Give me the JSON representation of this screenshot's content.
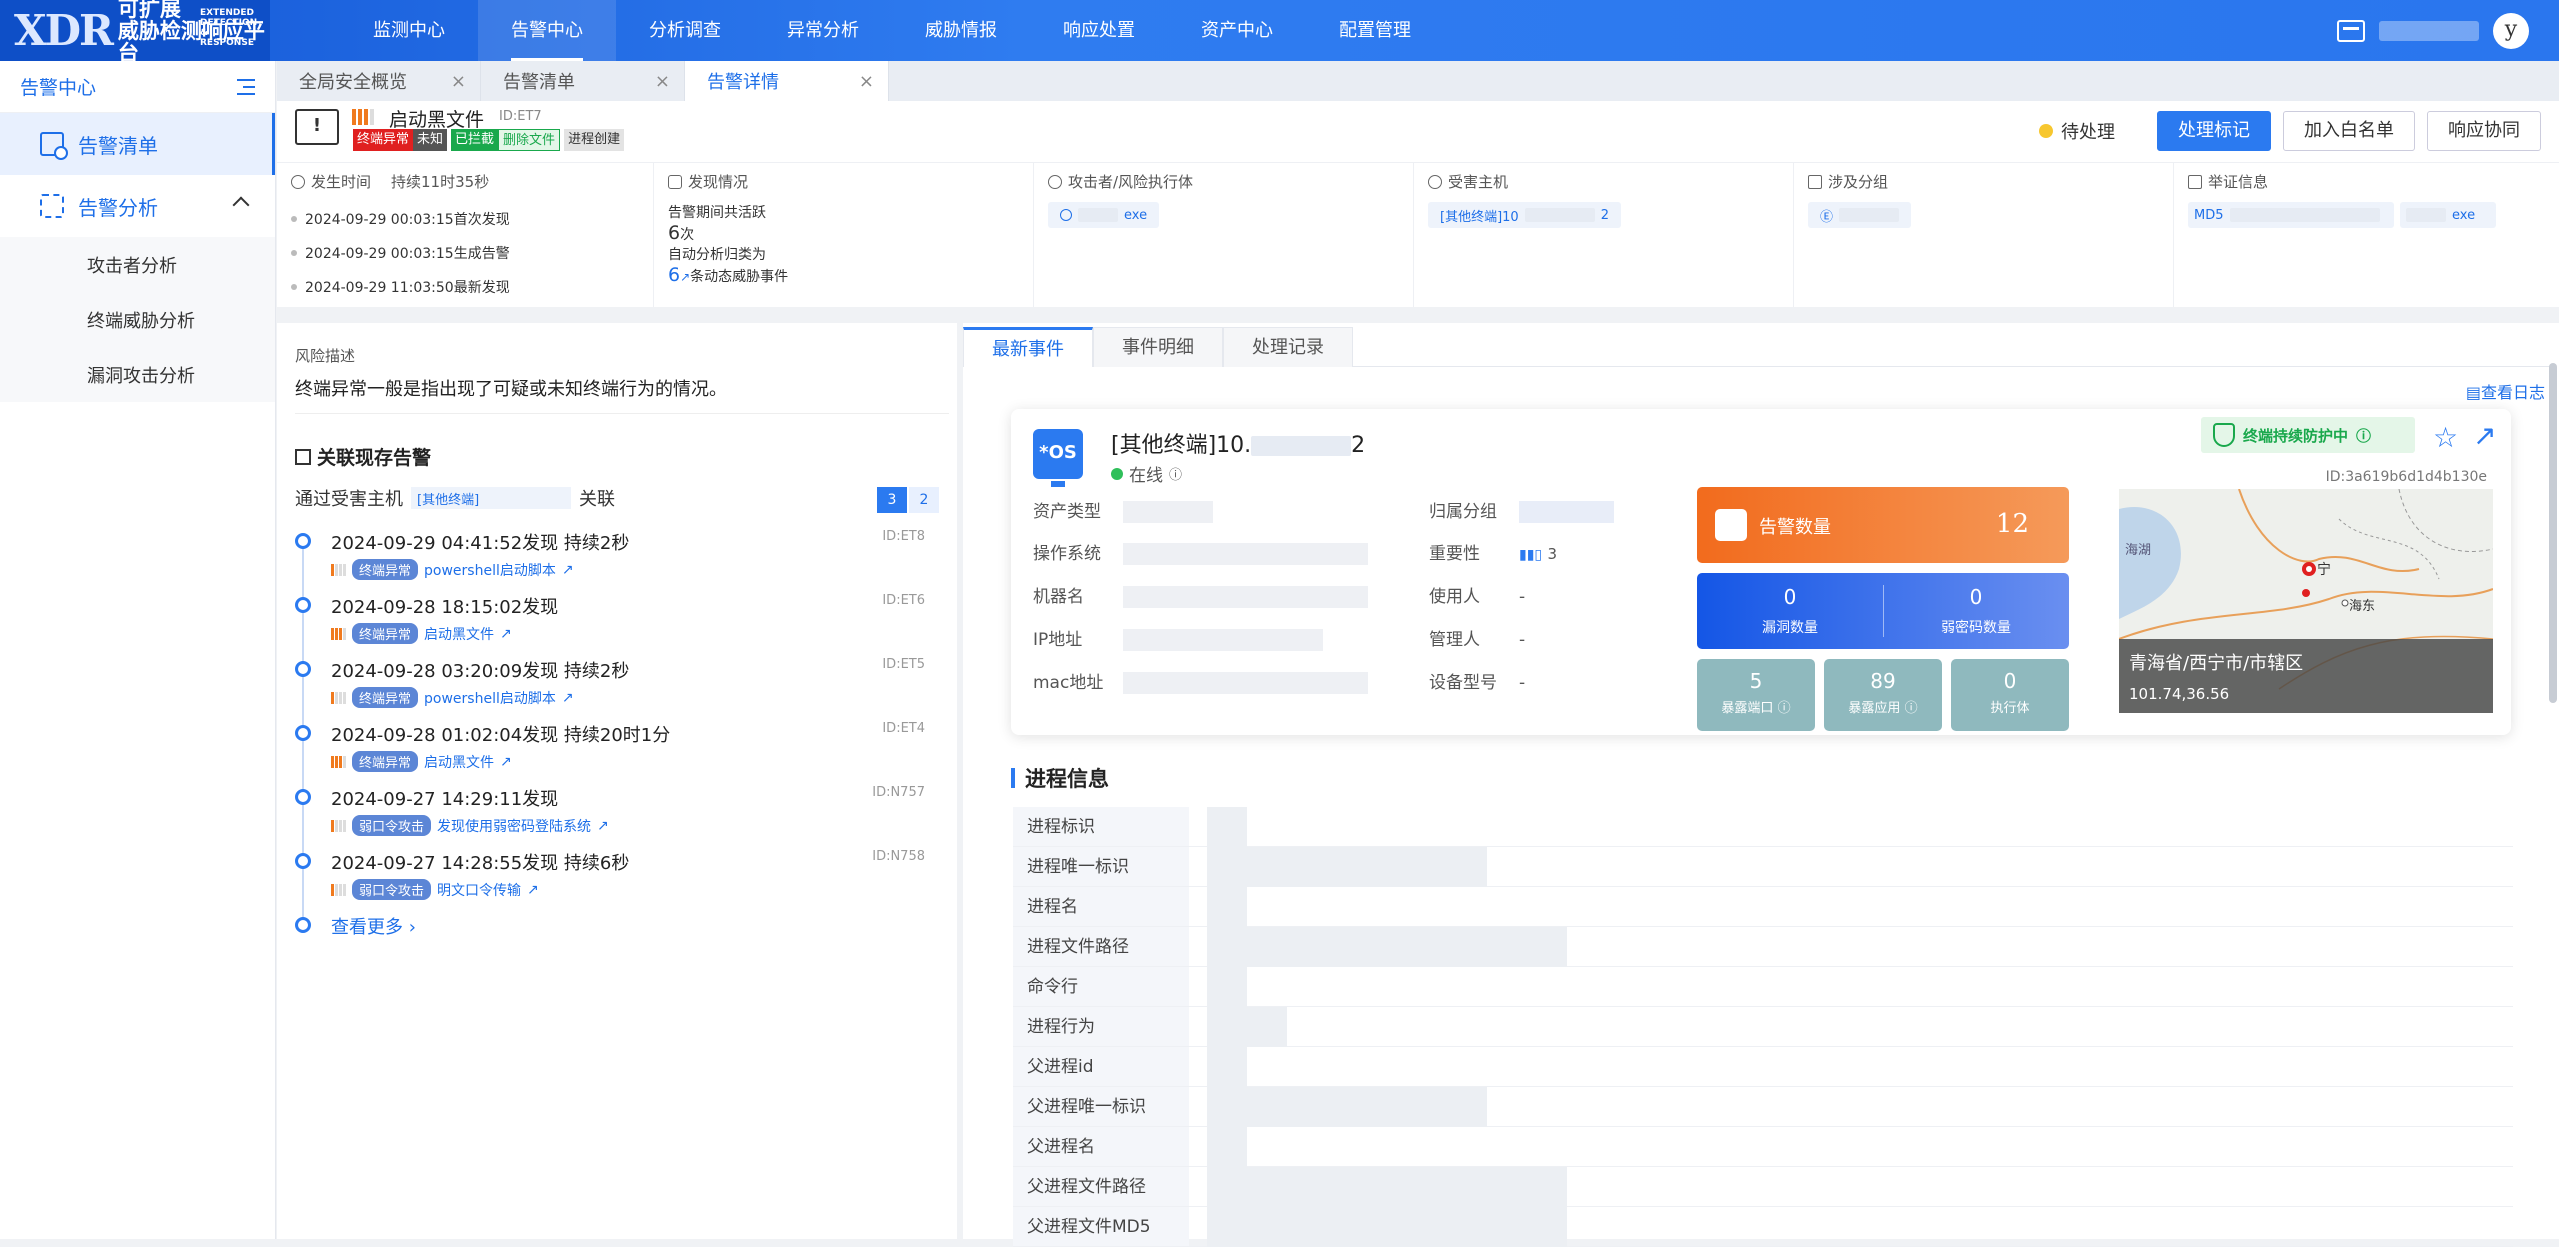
{
  "app": {
    "logo_abbr": "XDR",
    "logo_line1": "可扩展",
    "logo_line2": "威胁检测响应平台",
    "logo_en": "EXTENDED DETECTION & RESPONSE",
    "user_initial": "y"
  },
  "topnav": [
    "监测中心",
    "告警中心",
    "分析调查",
    "异常分析",
    "威胁情报",
    "响应处置",
    "资产中心",
    "配置管理"
  ],
  "sidebar": {
    "title": "告警中心",
    "items": [
      {
        "label": "告警清单"
      }
    ],
    "group": {
      "label": "告警分析",
      "children": [
        "攻击者分析",
        "终端威胁分析",
        "漏洞攻击分析"
      ]
    }
  },
  "tabs": [
    {
      "label": "全局安全概览"
    },
    {
      "label": "告警清单"
    },
    {
      "label": "告警详情"
    }
  ],
  "alert": {
    "title": "启动黑文件",
    "id": "ID:ET7",
    "tags": [
      "终端异常",
      "未知",
      "已拦截",
      "删除文件",
      "进程创建"
    ],
    "status": "待处理",
    "buttons": [
      "处理标记",
      "加入白名单",
      "响应协同"
    ]
  },
  "info": {
    "time_title": "发生时间",
    "duration": "持续11时35秒",
    "times": [
      "2024-09-29 00:03:15首次发现",
      "2024-09-29 00:03:15生成告警",
      "2024-09-29 11:03:50最新发现"
    ],
    "discover_title": "发现情况",
    "discover_line1": "告警期间共活跃",
    "active_count": "6",
    "active_unit": "次",
    "discover_line2": "自动分析归类为",
    "event_count": "6",
    "event_text": "条动态威胁事件",
    "attacker_title": "攻击者/风险执行体",
    "attacker_value": "exe",
    "victim_title": "受害主机",
    "victim_value": "[其他终端]10",
    "victim_count": "2",
    "group_title": "涉及分组",
    "group_value": "Ⓔ",
    "evidence_title": "举证信息",
    "evidence_md5": "MD5",
    "evidence_file": "exe"
  },
  "risk": {
    "title": "风险描述",
    "desc": "终端异常一般是指出现了可疑或未知终端行为的情况。"
  },
  "related": {
    "title": "关联现存告警",
    "via": "通过受害主机",
    "host": "[其他终端]",
    "via_suffix": "关联",
    "pages": [
      "3",
      "2"
    ],
    "items": [
      {
        "date": "2024-09-29 04:41:52发现 持续2秒",
        "id": "ID:ET8",
        "tag": "终端异常",
        "link": "powershell启动脚本"
      },
      {
        "date": "2024-09-28 18:15:02发现",
        "id": "ID:ET6",
        "tag": "终端异常",
        "link": "启动黑文件"
      },
      {
        "date": "2024-09-28 03:20:09发现 持续2秒",
        "id": "ID:ET5",
        "tag": "终端异常",
        "link": "powershell启动脚本"
      },
      {
        "date": "2024-09-28 01:02:04发现 持续20时1分",
        "id": "ID:ET4",
        "tag": "终端异常",
        "link": "启动黑文件"
      },
      {
        "date": "2024-09-27 14:29:11发现",
        "id": "ID:N757",
        "tag": "弱口令攻击",
        "link": "发现使用弱密码登陆系统"
      },
      {
        "date": "2024-09-27 14:28:55发现 持续6秒",
        "id": "ID:N758",
        "tag": "弱口令攻击",
        "link": "明文口令传输"
      }
    ],
    "more": "查看更多"
  },
  "rtabs": [
    "最新事件",
    "事件明细",
    "处理记录"
  ],
  "viewlog": "查看日志",
  "host": {
    "os_label": "*OS",
    "title": "[其他终端]10.",
    "title_tail": "2",
    "online": "在线",
    "protect": "终端持续防护中",
    "id": "ID:3a619b6d1d4b130e",
    "left_fields": [
      "资产类型",
      "操作系统",
      "机器名",
      "IP地址",
      "mac地址"
    ],
    "right_fields": [
      {
        "k": "归属分组",
        "v": ""
      },
      {
        "k": "重要性",
        "v": "3"
      },
      {
        "k": "使用人",
        "v": "-"
      },
      {
        "k": "管理人",
        "v": "-"
      },
      {
        "k": "设备型号",
        "v": "-"
      }
    ],
    "alert_count_label": "告警数量",
    "alert_count": "12",
    "vuln_count": "0",
    "vuln_label": "漏洞数量",
    "weak_count": "0",
    "weak_label": "弱密码数量",
    "ports": "5",
    "ports_label": "暴露端口",
    "apps": "89",
    "apps_label": "暴露应用",
    "exec": "0",
    "exec_label": "执行体",
    "map_lake": "海湖",
    "map_city": "宁",
    "map_haidong": "海东",
    "map_region": "青海省/西宁市/市辖区",
    "map_coord": "101.74,36.56"
  },
  "process": {
    "title": "进程信息",
    "rows": [
      "进程标识",
      "进程唯一标识",
      "进程名",
      "进程文件路径",
      "命令行",
      "进程行为",
      "父进程id",
      "父进程唯一标识",
      "父进程名",
      "父进程文件路径",
      "父进程文件MD5"
    ]
  }
}
